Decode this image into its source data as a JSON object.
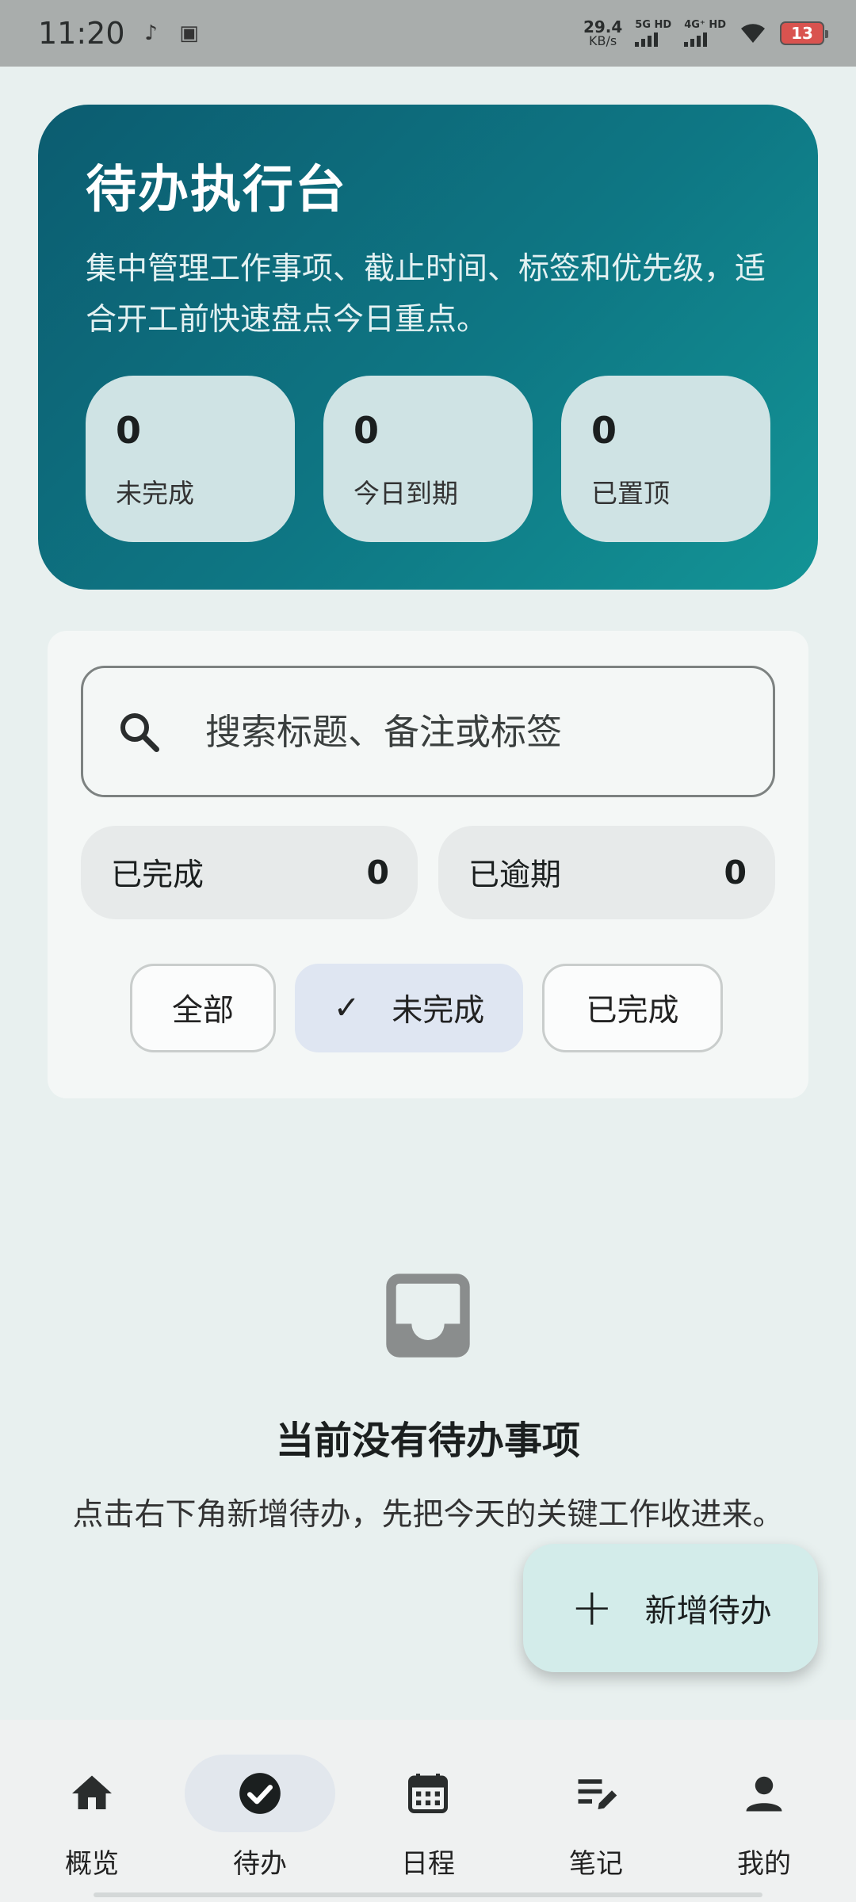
{
  "status_bar": {
    "time": "11:20",
    "net_speed_value": "29.4",
    "net_speed_unit": "KB/s",
    "signal1_label": "5G HD",
    "signal2_label": "4G⁺ HD",
    "battery": "13"
  },
  "hero": {
    "title": "待办执行台",
    "description": "集中管理工作事项、截止时间、标签和优先级，适合开工前快速盘点今日重点。",
    "stats": [
      {
        "value": "0",
        "label": "未完成"
      },
      {
        "value": "0",
        "label": "今日到期"
      },
      {
        "value": "0",
        "label": "已置顶"
      }
    ]
  },
  "search": {
    "placeholder": "搜索标题、备注或标签"
  },
  "counters": [
    {
      "label": "已完成",
      "value": "0"
    },
    {
      "label": "已逾期",
      "value": "0"
    }
  ],
  "filters": {
    "options": [
      "全部",
      "未完成",
      "已完成"
    ],
    "selected": "未完成"
  },
  "empty_state": {
    "icon": "inbox-icon",
    "title": "当前没有待办事项",
    "description": "点击右下角新增待办，先把今天的关键工作收进来。"
  },
  "fab": {
    "label": "新增待办",
    "icon": "plus-icon"
  },
  "bottom_nav": {
    "items": [
      {
        "label": "概览",
        "icon": "home-icon"
      },
      {
        "label": "待办",
        "icon": "check-circle-icon"
      },
      {
        "label": "日程",
        "icon": "calendar-icon"
      },
      {
        "label": "笔记",
        "icon": "note-edit-icon"
      },
      {
        "label": "我的",
        "icon": "person-icon"
      }
    ],
    "active": "待办"
  },
  "colors": {
    "hero_gradient_start": "#0c5c70",
    "hero_gradient_end": "#139496",
    "stat_card_bg": "#cfe3e4",
    "fab_bg": "#d3ecea",
    "selected_filter_bg": "#dfe6f2",
    "page_bg": "#e8f0ef"
  }
}
